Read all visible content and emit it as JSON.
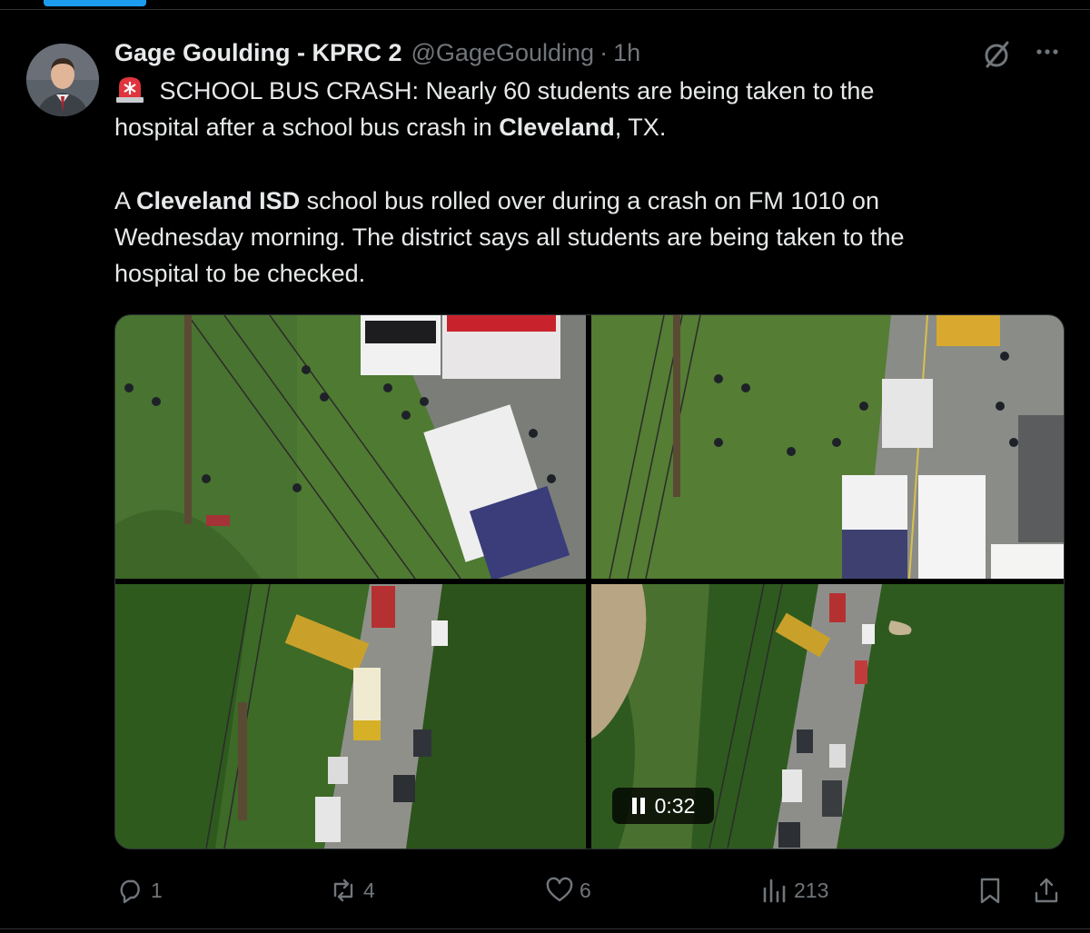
{
  "tweet": {
    "author_name": "Gage Goulding - KPRC 2",
    "handle": "@GageGoulding",
    "separator": "·",
    "time": "1h",
    "line1_text": " SCHOOL BUS CRASH: Nearly 60 students are being taken to the",
    "line2_before": "hospital after a school bus crash in ",
    "line2_bold": "Cleveland",
    "line2_after": ", TX.",
    "p2_a": "A ",
    "p2_bold": "Cleveland ISD",
    "p2_b": " school bus rolled over during a crash on FM 1010 on",
    "p2_line2": "Wednesday morning. The district says all students are being taken to the",
    "p2_line3": "hospital to be checked."
  },
  "media": {
    "video_time": "0:32",
    "state": "playing"
  },
  "actions": {
    "replies": "1",
    "reposts": "4",
    "likes": "6",
    "views": "213"
  },
  "icons": [
    "avatar",
    "siren-icon",
    "grok-icon",
    "more-icon",
    "pause-icon",
    "reply-icon",
    "repost-icon",
    "like-icon",
    "views-icon",
    "bookmark-icon",
    "share-icon"
  ],
  "colors": {
    "background": "#000000",
    "text": "#e7e9ea",
    "secondary": "#71767b",
    "accent": "#1d9bf0",
    "border": "#2f3336"
  }
}
